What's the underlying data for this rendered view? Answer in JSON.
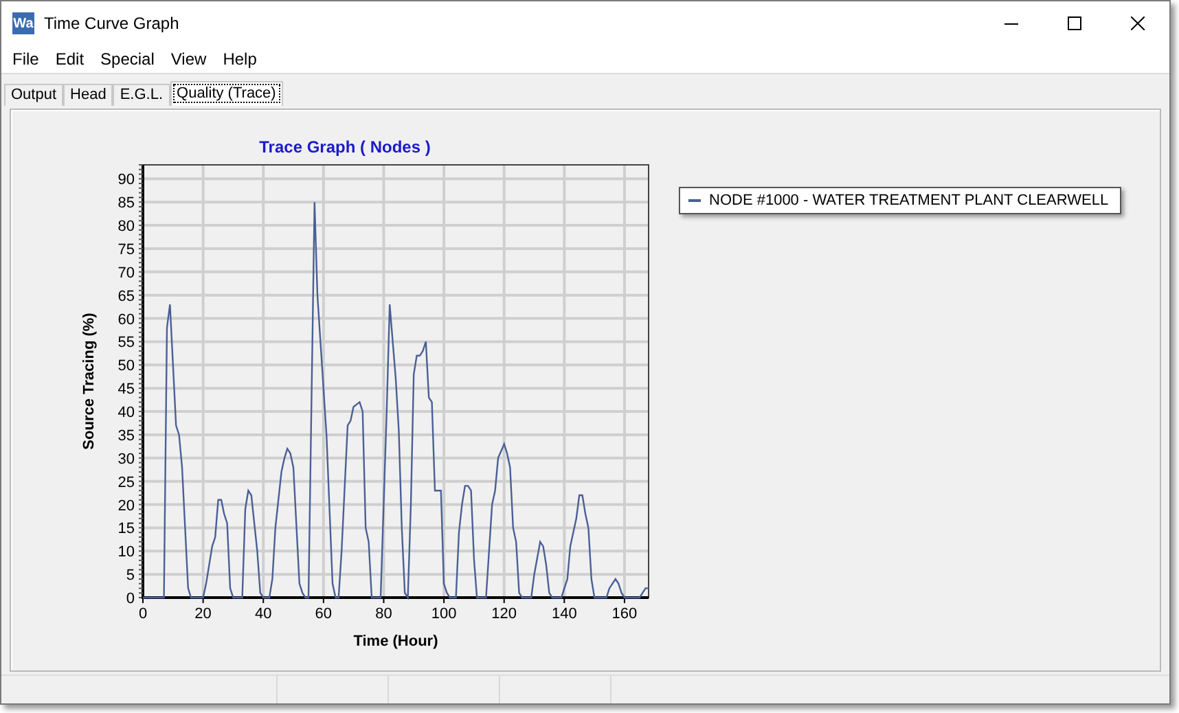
{
  "window": {
    "app_icon_label": "Wa",
    "title": "Time Curve Graph"
  },
  "menu": [
    "File",
    "Edit",
    "Special",
    "View",
    "Help"
  ],
  "tabs": [
    {
      "label": "Output",
      "selected": false
    },
    {
      "label": "Head",
      "selected": false
    },
    {
      "label": "E.G.L.",
      "selected": false
    },
    {
      "label": "Quality (Trace)",
      "selected": true
    }
  ],
  "graph": {
    "chart_data": {
      "type": "line",
      "title": "Trace Graph ( Nodes )",
      "xlabel": "Time (Hour)",
      "ylabel": "Source Tracing (%)",
      "grid": true,
      "xlim": [
        0,
        168
      ],
      "ylim": [
        0,
        93
      ],
      "xticks": [
        0,
        20,
        40,
        60,
        80,
        100,
        120,
        140,
        160
      ],
      "yticks": [
        0,
        5,
        10,
        15,
        20,
        25,
        30,
        35,
        40,
        45,
        50,
        55,
        60,
        65,
        70,
        75,
        80,
        85,
        90
      ],
      "x": [
        0,
        7,
        8,
        9,
        11,
        12,
        13,
        15,
        16,
        20,
        21,
        22,
        23,
        24,
        25,
        26,
        27,
        28,
        29,
        30,
        33,
        34,
        35,
        36,
        38,
        39,
        40,
        42,
        43,
        44,
        46,
        47,
        48,
        49,
        50,
        52,
        53,
        54,
        55,
        57,
        58,
        61,
        63,
        64,
        65,
        66,
        68,
        69,
        70,
        72,
        73,
        74,
        75,
        76,
        79,
        81,
        82,
        83,
        84,
        85,
        86,
        87,
        88,
        89,
        90,
        91,
        92,
        93,
        94,
        95,
        96,
        97,
        99,
        100,
        101,
        102,
        104,
        105,
        106,
        107,
        108,
        109,
        110,
        111,
        114,
        116,
        117,
        118,
        120,
        121,
        122,
        123,
        124,
        125,
        126,
        129,
        130,
        132,
        133,
        134,
        135,
        136,
        139,
        140,
        141,
        142,
        144,
        145,
        146,
        147,
        148,
        149,
        150,
        154,
        155,
        156,
        157,
        158,
        159,
        160,
        165,
        167,
        168
      ],
      "series": [
        {
          "name": "NODE #1000 - WATER TREATMENT PLANT CLEARWELL",
          "color": "#4a5f96",
          "values": [
            0,
            0,
            58,
            63,
            37,
            35,
            28,
            2,
            0,
            0,
            3,
            7,
            11,
            13,
            21,
            21,
            18,
            16,
            2,
            0,
            0,
            19,
            23,
            22,
            10,
            1,
            0,
            0,
            4,
            15,
            27,
            30,
            32,
            31,
            28,
            3,
            1,
            0,
            0,
            85,
            65,
            35,
            3,
            0,
            0,
            10,
            37,
            38,
            41,
            42,
            40,
            15,
            12,
            0,
            0,
            40,
            63,
            55,
            47,
            36,
            15,
            1,
            0,
            20,
            48,
            52,
            52,
            53,
            55,
            43,
            42,
            23,
            23,
            3,
            1,
            0,
            0,
            14,
            20,
            24,
            24,
            23,
            8,
            0,
            0,
            20,
            23,
            30,
            33,
            31,
            28,
            15,
            12,
            1,
            0,
            0,
            5,
            12,
            11,
            7,
            1,
            0,
            0,
            2,
            4,
            11,
            17,
            22,
            22,
            18,
            15,
            4,
            0,
            0,
            2,
            3,
            4,
            3,
            1,
            0,
            0,
            2,
            2
          ]
        }
      ]
    }
  }
}
